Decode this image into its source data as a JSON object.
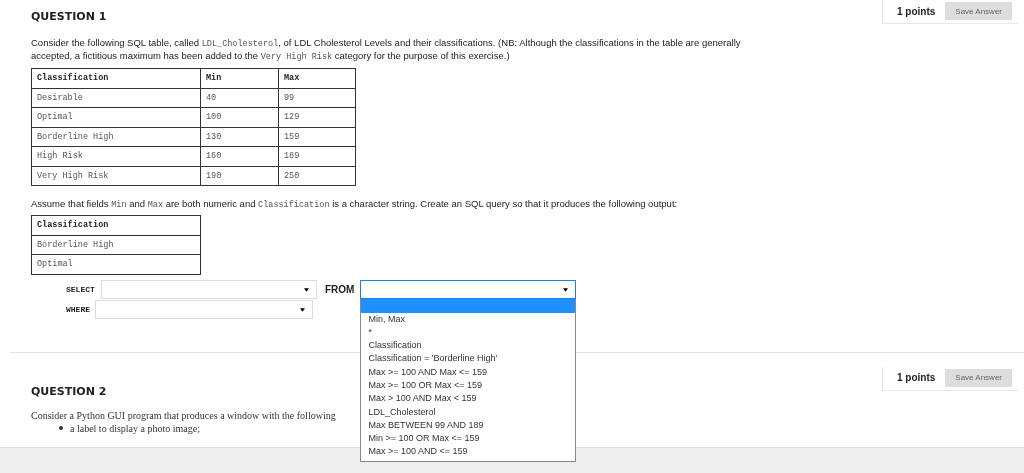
{
  "questions": [
    {
      "title": "QUESTION 1",
      "points": "1 points",
      "save_button": "Save Answer"
    },
    {
      "title": "QUESTION 2",
      "points": "1 points",
      "save_button": "Save Answer"
    }
  ],
  "q1": {
    "intro": [
      {
        "kind": "text",
        "text": "Consider the following SQL table, called "
      },
      {
        "kind": "code",
        "text": "LDL_Cholesterol"
      },
      {
        "kind": "text",
        "text": ", of LDL Cholesterol Levels and their classifications.  (NB: Although the classifications in the table are generally accepted, a fictitious maximum has been added to the "
      },
      {
        "kind": "code",
        "text": "Very High Risk"
      },
      {
        "kind": "text",
        "text": " category for the purpose of this exercise.)"
      }
    ],
    "table": {
      "columns": [
        "Classification",
        "Min",
        "Max"
      ],
      "rows": [
        [
          "Desirable",
          "40",
          "99"
        ],
        [
          "Optimal",
          "100",
          "129"
        ],
        [
          "Borderline High",
          "130",
          "159"
        ],
        [
          "High Risk",
          "160",
          "189"
        ],
        [
          "Very High Risk",
          "190",
          "250"
        ]
      ]
    },
    "prompt": [
      {
        "kind": "text",
        "text": "Assume that fields "
      },
      {
        "kind": "code",
        "text": "Min"
      },
      {
        "kind": "text",
        "text": " and "
      },
      {
        "kind": "code",
        "text": "Max"
      },
      {
        "kind": "text",
        "text": " are both numeric and "
      },
      {
        "kind": "code",
        "text": "Classification"
      },
      {
        "kind": "text",
        "text": " is a character string.  Create an SQL query so that it produces the following output:"
      }
    ],
    "output_table": {
      "columns": [
        "Classification"
      ],
      "rows": [
        [
          "Borderline High"
        ],
        [
          "Optimal"
        ]
      ]
    },
    "query": {
      "select_label": "SELECT",
      "from_label": "FROM",
      "where_label": "WHERE",
      "from_dropdown": {
        "expanded": true,
        "blank_option_highlighted": true,
        "options": [
          "Min, Max",
          "*",
          "Classification",
          "Classification = 'Borderline High'",
          "Max >= 100 AND Max <= 159",
          "Max >= 100 OR Max <= 159",
          "Max > 100 AND Max < 159",
          "LDL_Cholesterol",
          "Max BETWEEN 99 AND 189",
          "Min >= 100 OR Max <= 159",
          "Max >= 100 AND <= 159"
        ]
      }
    }
  },
  "q2": {
    "text": "Consider a Python GUI program that produces a window with the following",
    "bullets": [
      "a label to display a photo image;"
    ]
  }
}
